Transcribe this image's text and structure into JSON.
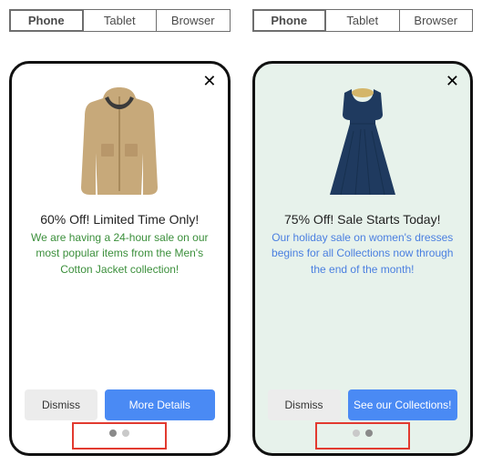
{
  "tabs": {
    "phone": "Phone",
    "tablet": "Tablet",
    "browser": "Browser"
  },
  "left": {
    "headline": "60% Off! Limited Time Only!",
    "desc": "We are having a 24-hour sale on our most popular items from the Men's Cotton Jacket collection!",
    "dismiss": "Dismiss",
    "cta": "More Details",
    "dots": {
      "count": 2,
      "activeIndex": 0
    },
    "image": "mens-cotton-jacket"
  },
  "right": {
    "headline": "75% Off! Sale Starts Today!",
    "desc": "Our holiday sale on women's dresses begins for all Collections now through the end of the month!",
    "dismiss": "Dismiss",
    "cta": "See our Collections!",
    "dots": {
      "count": 2,
      "activeIndex": 1
    },
    "image": "womens-dress-navy"
  },
  "colors": {
    "primary": "#4a8af4",
    "highlight": "#e23a2f",
    "descGreen": "#3b8f3b",
    "descBlue": "#4a7fe0"
  }
}
